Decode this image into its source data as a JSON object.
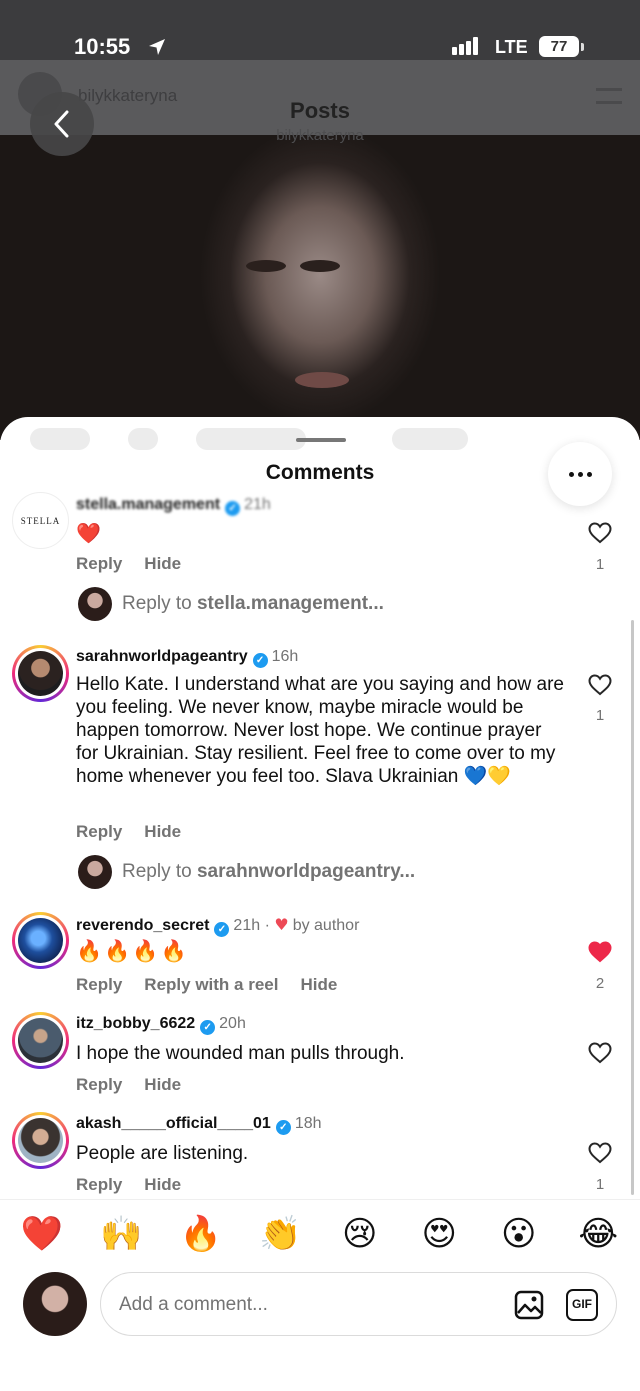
{
  "status_bar": {
    "time": "10:55",
    "network": "LTE",
    "battery": "77"
  },
  "background_header": {
    "username": "bilykkateryna",
    "title": "Posts",
    "subtitle": "bilykkateryna"
  },
  "sheet": {
    "title": "Comments"
  },
  "comments": [
    {
      "username": "stella.management",
      "time": "21h",
      "verified": true,
      "text": "❤️",
      "actions": [
        "Reply",
        "Hide"
      ],
      "likes": "1",
      "liked": false,
      "reply_prompt": {
        "prefix": "Reply to ",
        "target": "stella.management..."
      }
    },
    {
      "username": "sarahnworldpageantry",
      "time": "16h",
      "verified": true,
      "text": "Hello Kate. I understand what are you saying and how are you feeling. We never know, maybe miracle would be happen tomorrow. Never lost hope. We continue prayer for Ukrainian. Stay resilient. Feel free to come over to my home whenever you feel too. Slava Ukrainian 💙💛",
      "actions": [
        "Reply",
        "Hide"
      ],
      "likes": "1",
      "liked": false,
      "reply_prompt": {
        "prefix": "Reply to ",
        "target": "sarahnworldpageantry..."
      }
    },
    {
      "username": "reverendo_secret",
      "time": "21h",
      "verified": true,
      "author_note": "by author",
      "text": "🔥🔥🔥🔥",
      "actions": [
        "Reply",
        "Reply with a reel",
        "Hide"
      ],
      "likes": "2",
      "liked": true
    },
    {
      "username": "itz_bobby_6622",
      "time": "20h",
      "verified": true,
      "text": "I hope the wounded man pulls through.",
      "actions": [
        "Reply",
        "Hide"
      ],
      "likes": "",
      "liked": false
    },
    {
      "username": "akash_____official____01",
      "time": "18h",
      "verified": true,
      "text": "People are listening.",
      "actions": [
        "Reply",
        "Hide"
      ],
      "likes": "1",
      "liked": false
    }
  ],
  "emoji_bar": [
    "❤️",
    "🙌",
    "🔥",
    "👏",
    "😢",
    "😍",
    "😮",
    "😂"
  ],
  "composer": {
    "placeholder": "Add a comment...",
    "gif_label": "GIF"
  },
  "colors": {
    "accent_red": "#ed4956",
    "verified_blue": "#1d9bf0",
    "muted_text": "#737373"
  }
}
